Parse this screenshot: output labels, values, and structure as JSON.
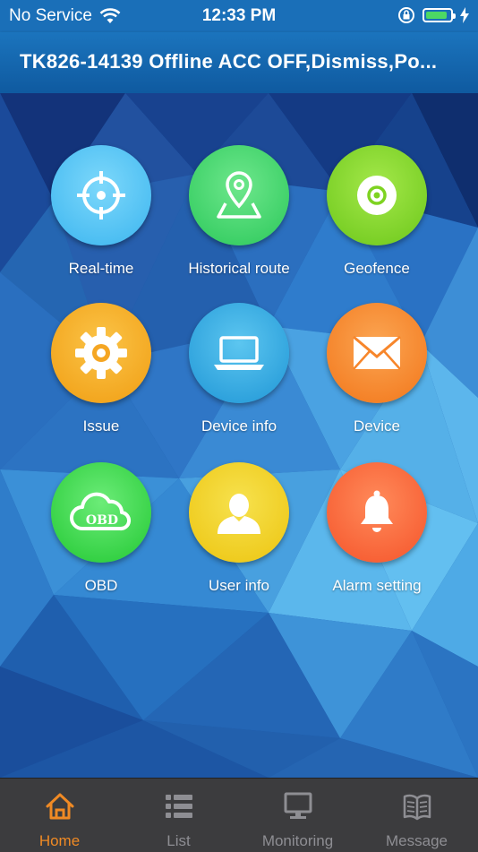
{
  "status_bar": {
    "carrier": "No Service",
    "time": "12:33 PM"
  },
  "header": {
    "title": "TK826-14139 Offline ACC OFF,Dismiss,Po..."
  },
  "menu": {
    "items": [
      {
        "label": "Real-time",
        "icon": "crosshair-icon",
        "color": "#4fc3f7"
      },
      {
        "label": "Historical route",
        "icon": "map-pin-icon",
        "color": "#3fd66b"
      },
      {
        "label": "Geofence",
        "icon": "geofence-icon",
        "color": "#7ed321"
      },
      {
        "label": "Issue",
        "icon": "gear-icon",
        "color": "#f5a623"
      },
      {
        "label": "Device info",
        "icon": "laptop-icon",
        "color": "#29a9e0"
      },
      {
        "label": "Device",
        "icon": "envelope-icon",
        "color": "#f7862b"
      },
      {
        "label": "OBD",
        "icon": "obd-cloud-icon",
        "color": "#3ddc4f"
      },
      {
        "label": "User info",
        "icon": "user-icon",
        "color": "#f2d21b"
      },
      {
        "label": "Alarm setting",
        "icon": "bell-icon",
        "color": "#fb6b3c"
      }
    ]
  },
  "tabbar": {
    "tabs": [
      {
        "label": "Home",
        "icon": "home-icon",
        "active": true
      },
      {
        "label": "List",
        "icon": "list-icon",
        "active": false
      },
      {
        "label": "Monitoring",
        "icon": "monitor-icon",
        "active": false
      },
      {
        "label": "Message",
        "icon": "book-icon",
        "active": false
      }
    ],
    "active_color": "#f08a24",
    "inactive_color": "#8e8e93"
  }
}
